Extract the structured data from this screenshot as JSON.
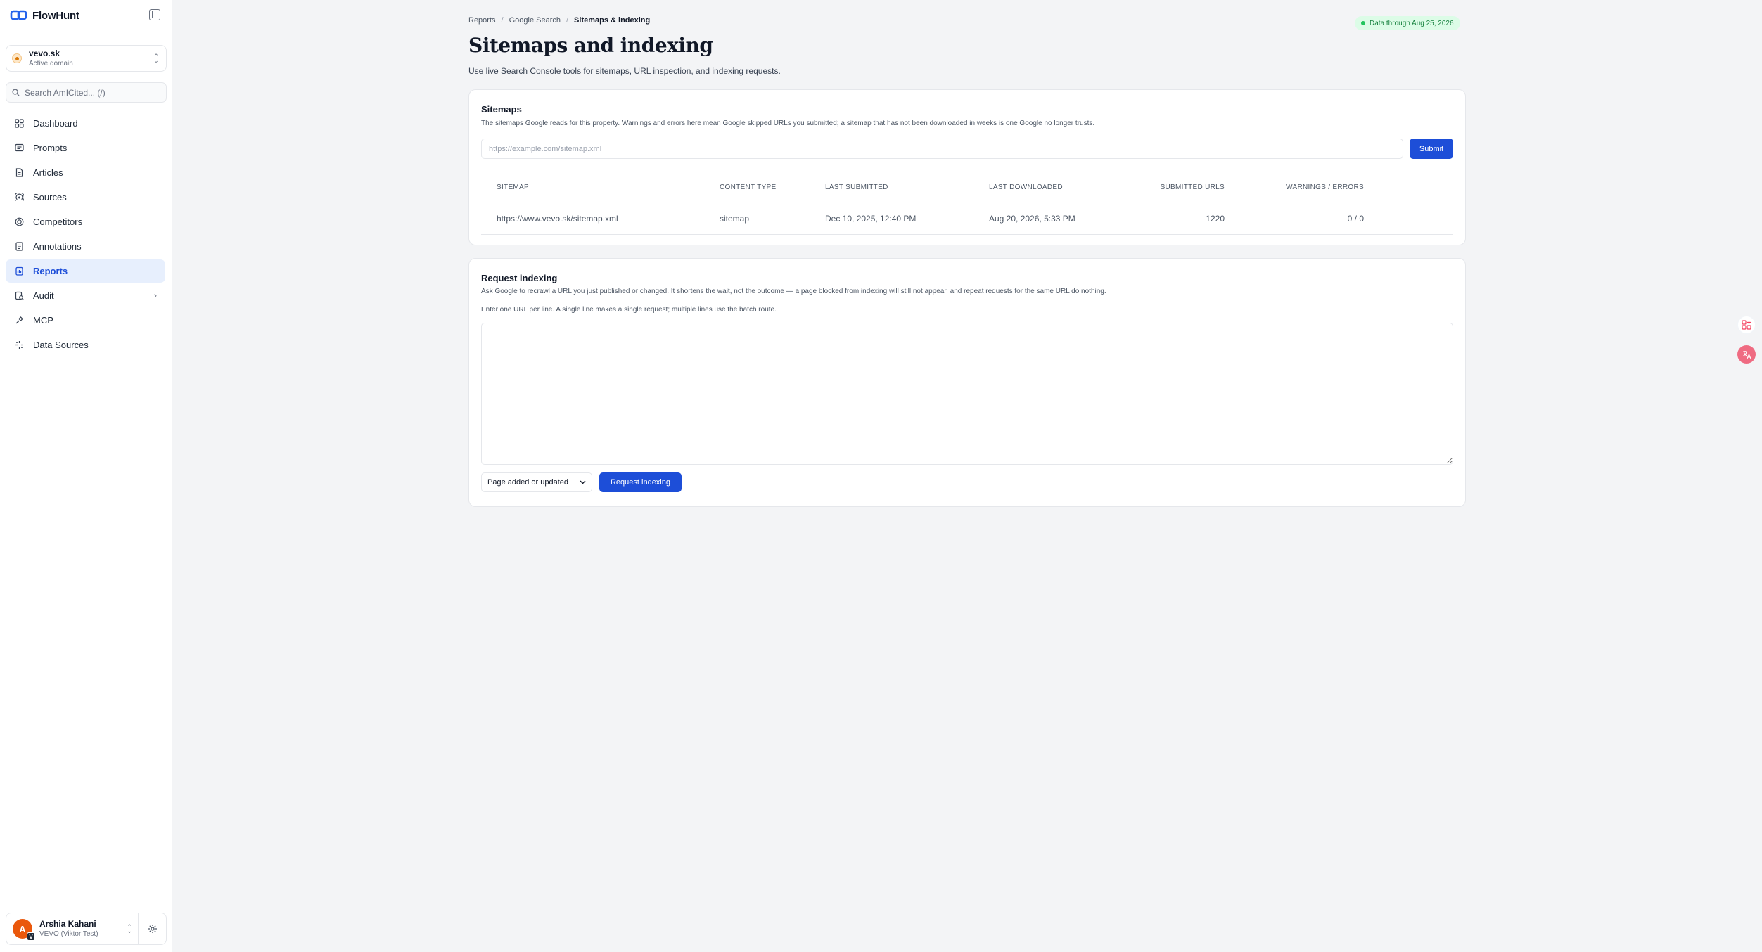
{
  "brand": {
    "name": "FlowHunt"
  },
  "domain": {
    "name": "vevo.sk",
    "status": "Active domain"
  },
  "search": {
    "placeholder": "Search AmICited... (/)"
  },
  "sidebar": {
    "items": [
      {
        "label": "Dashboard",
        "icon": "dashboard-icon"
      },
      {
        "label": "Prompts",
        "icon": "prompts-icon"
      },
      {
        "label": "Articles",
        "icon": "articles-icon"
      },
      {
        "label": "Sources",
        "icon": "sources-icon"
      },
      {
        "label": "Competitors",
        "icon": "competitors-icon"
      },
      {
        "label": "Annotations",
        "icon": "annotations-icon"
      },
      {
        "label": "Reports",
        "icon": "reports-icon",
        "active": true
      },
      {
        "label": "Audit",
        "icon": "audit-icon",
        "has_submenu": true
      },
      {
        "label": "MCP",
        "icon": "mcp-icon"
      },
      {
        "label": "Data Sources",
        "icon": "data-sources-icon"
      }
    ]
  },
  "user": {
    "name": "Arshia Kahani",
    "org": "VEVO (Viktor Test)",
    "initial": "A",
    "badge": "V"
  },
  "breadcrumb": {
    "level1": "Reports",
    "level2": "Google Search",
    "current": "Sitemaps & indexing"
  },
  "badge": {
    "text": "Data through Aug 25, 2026"
  },
  "page": {
    "title": "Sitemaps and indexing",
    "subtitle": "Use live Search Console tools for sitemaps, URL inspection, and indexing requests."
  },
  "sitemaps": {
    "title": "Sitemaps",
    "description": "The sitemaps Google reads for this property. Warnings and errors here mean Google skipped URLs you submitted; a sitemap that has not been downloaded in weeks is one Google no longer trusts.",
    "input_placeholder": "https://example.com/sitemap.xml",
    "submit_label": "Submit",
    "columns": [
      "SITEMAP",
      "CONTENT TYPE",
      "LAST SUBMITTED",
      "LAST DOWNLOADED",
      "SUBMITTED URLS",
      "WARNINGS / ERRORS"
    ],
    "rows": [
      {
        "sitemap": "https://www.vevo.sk/sitemap.xml",
        "content_type": "sitemap",
        "last_submitted": "Dec 10, 2025, 12:40 PM",
        "last_downloaded": "Aug 20, 2026, 5:33 PM",
        "submitted_urls": "1220",
        "warnings_errors": "0 / 0"
      }
    ]
  },
  "request": {
    "title": "Request indexing",
    "description": "Ask Google to recrawl a URL you just published or changed. It shortens the wait, not the outcome — a page blocked from indexing will still not appear, and repeat requests for the same URL do nothing.",
    "hint": "Enter one URL per line. A single line makes a single request; multiple lines use the batch route.",
    "urls_value": "",
    "reason_selected": "Page added or updated",
    "button_label": "Request indexing"
  },
  "colors": {
    "accent": "#1d4ed8",
    "active_bg": "#e7effd",
    "badge_bg": "#dcfce7",
    "badge_text": "#15803d"
  }
}
